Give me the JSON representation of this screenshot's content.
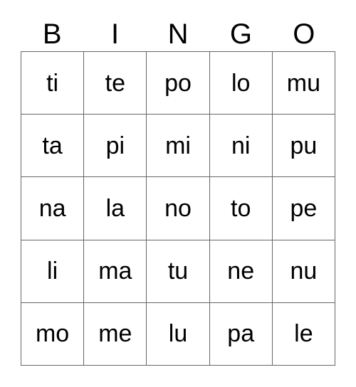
{
  "card": {
    "header_letters": [
      "B",
      "I",
      "N",
      "G",
      "O"
    ],
    "rows": [
      [
        "ti",
        "te",
        "po",
        "lo",
        "mu"
      ],
      [
        "ta",
        "pi",
        "mi",
        "ni",
        "pu"
      ],
      [
        "na",
        "la",
        "no",
        "to",
        "pe"
      ],
      [
        "li",
        "ma",
        "tu",
        "ne",
        "nu"
      ],
      [
        "mo",
        "me",
        "lu",
        "pa",
        "le"
      ]
    ],
    "colors": {
      "text": "#000000",
      "border": "#666666",
      "background": "#ffffff"
    }
  }
}
